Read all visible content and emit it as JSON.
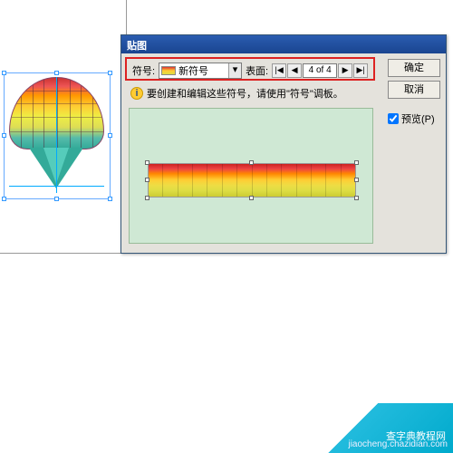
{
  "dialog": {
    "title": "贴图",
    "symbol_label": "符号:",
    "symbol_value": "新符号",
    "face_label": "表面:",
    "nav": {
      "first": "|◀",
      "prev": "◀",
      "value": "4 of 4",
      "next": "▶",
      "last": "▶|"
    },
    "info_text": "要创建和编辑这些符号，请使用\"符号\"调板。",
    "ok": "确定",
    "cancel": "取消",
    "preview_label": "预览(P)"
  },
  "watermark": {
    "line1": "查字典教程网",
    "line2": "jiaocheng.chazidian.com"
  }
}
